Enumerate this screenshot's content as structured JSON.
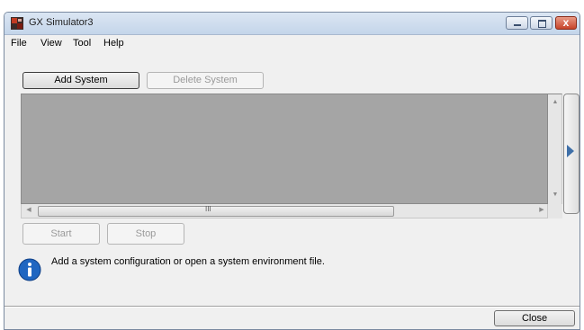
{
  "window": {
    "title": "GX Simulator3",
    "app_icon": "gx-simulator-icon",
    "close_glyph": "x"
  },
  "menu": [
    "File",
    "View",
    "Tool",
    "Help"
  ],
  "toolbar": {
    "add_label": "Add System",
    "delete_label": "Delete System"
  },
  "scroll": {
    "grip": "III",
    "up": "▲",
    "down": "▼",
    "left": "◀",
    "right": "▶"
  },
  "controls": {
    "start_label": "Start",
    "stop_label": "Stop"
  },
  "info": {
    "icon": "info-icon",
    "message": "Add a system configuration or open a system environment file."
  },
  "footer": {
    "close_label": "Close"
  },
  "colors": {
    "title_bar": "#c4d5ea",
    "system_area": "#a5a5a5",
    "info_blue": "#1f66c1",
    "expand_arrow": "#3e6fa8",
    "close_red": "#c7442a"
  }
}
